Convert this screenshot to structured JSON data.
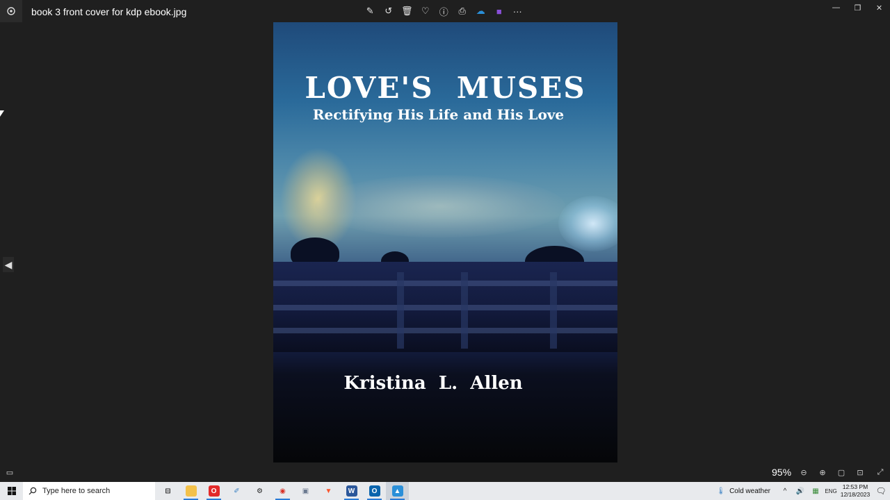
{
  "window": {
    "title": "book 3 front cover for kdp ebook.jpg",
    "toolbar": [
      {
        "name": "edit-image-icon",
        "glyph": "✎"
      },
      {
        "name": "rotate-icon",
        "glyph": "↺"
      },
      {
        "name": "delete-icon",
        "glyph": "🗑"
      },
      {
        "name": "favorite-icon",
        "glyph": "♡"
      },
      {
        "name": "info-icon",
        "glyph": "ⓘ"
      },
      {
        "name": "print-icon",
        "glyph": "⎙"
      },
      {
        "name": "onedrive-icon",
        "glyph": "☁"
      },
      {
        "name": "clipchamp-icon",
        "glyph": "■"
      },
      {
        "name": "more-options-icon",
        "glyph": "···"
      }
    ],
    "controls": {
      "minimize": "—",
      "restore": "❐",
      "close": "✕"
    }
  },
  "cover": {
    "title": "LOVE'S  MUSES",
    "subtitle": "Rectifying His Life and His Love",
    "author": "Kristina  L.  Allen"
  },
  "status": {
    "zoom": "95%"
  },
  "taskbar": {
    "search_placeholder": "Type here to search",
    "apps": [
      {
        "name": "task-view-icon",
        "glyph": "⊟",
        "color": "#e8eaed",
        "fg": "#222"
      },
      {
        "name": "file-explorer-icon",
        "glyph": "▇",
        "color": "#f3c14a",
        "fg": "#f3c14a"
      },
      {
        "name": "opera-icon",
        "glyph": "O",
        "color": "#e32a2a",
        "fg": "#fff"
      },
      {
        "name": "paint-icon",
        "glyph": "✐",
        "color": "#e8eaed",
        "fg": "#3b82c4"
      },
      {
        "name": "settings-icon",
        "glyph": "⚙",
        "color": "#e8eaed",
        "fg": "#222"
      },
      {
        "name": "chrome-icon",
        "glyph": "◉",
        "color": "#e8eaed",
        "fg": "#d93025"
      },
      {
        "name": "photos-app-icon",
        "glyph": "▣",
        "color": "#e8eaed",
        "fg": "#6b7a90"
      },
      {
        "name": "brave-icon",
        "glyph": "▼",
        "color": "#e8eaed",
        "fg": "#fb542b"
      },
      {
        "name": "word-icon",
        "glyph": "W",
        "color": "#2b579a",
        "fg": "#fff"
      },
      {
        "name": "outlook-icon",
        "glyph": "O",
        "color": "#0a64ad",
        "fg": "#fff"
      },
      {
        "name": "photos-icon",
        "glyph": "▲",
        "color": "#2a8fd8",
        "fg": "#fff"
      }
    ],
    "weather": "Cold weather",
    "language": "ENG",
    "time": "12:53 PM",
    "date": "12/18/2023"
  }
}
